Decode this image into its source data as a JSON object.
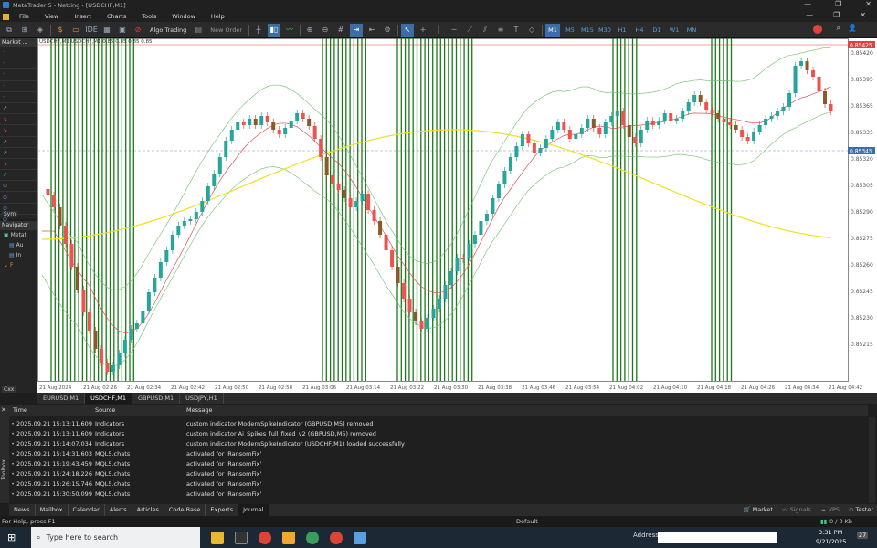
{
  "window": {
    "title": "MetaTrader 5 - Netting - [USDCHF,M1]",
    "minimize": "—",
    "maximize": "❐",
    "close": "✕"
  },
  "menu": {
    "items": [
      "File",
      "View",
      "Insert",
      "Charts",
      "Tools",
      "Window",
      "Help"
    ],
    "controls": [
      "—",
      "❐",
      "✕"
    ]
  },
  "toolbar": {
    "algo_trading_label": "Algo Trading",
    "new_order_label": "New Order",
    "timeframes": [
      "M1",
      "M5",
      "M15",
      "M30",
      "H1",
      "H4",
      "D1",
      "W1",
      "MN"
    ],
    "active_timeframe": "M1",
    "icons": [
      "new-chart-icon",
      "profiles-icon",
      "bar-chart-icon",
      "candle-icon",
      "line-chart-icon",
      "zoom-in-icon",
      "zoom-out-icon",
      "grid-icon",
      "autoscroll-icon",
      "shift-icon",
      "crosshair-icon",
      "cursor-icon",
      "vertical-line-icon",
      "horizontal-line-icon",
      "trendline-icon",
      "channel-icon",
      "fibonacci-icon",
      "text-icon",
      "shapes-icon"
    ]
  },
  "market_watch": {
    "title": "Market ...",
    "rows": [
      "·",
      "·",
      "·",
      "·",
      "·",
      "↗",
      "↘",
      "↘",
      "↗",
      "↗",
      "↘",
      "↗",
      "⊙",
      "⊙",
      "⊙",
      "⊙"
    ],
    "symbols_button": "Sym"
  },
  "navigator": {
    "title": "Navigator",
    "items": [
      "Metat",
      "Au",
      "In",
      "F"
    ]
  },
  "chart": {
    "symbol_label": "USDCHF,M1  USDCHF,M1 0.85 0.85 0.85 0.85",
    "price_labels": [
      "0.85420",
      "0.85395",
      "0.85365",
      "0.85335",
      "0.85320",
      "0.85305",
      "0.85290",
      "0.85275",
      "0.85260",
      "0.85245",
      "0.85230",
      "0.85215"
    ],
    "current_price_high": "0.85425",
    "current_price": "0.85345",
    "time_labels": [
      "21 Aug 2024",
      "21 Aug 02:26",
      "21 Aug 02:34",
      "21 Aug 02:42",
      "21 Aug 02:50",
      "21 Aug 02:58",
      "21 Aug 03:06",
      "21 Aug 03:14",
      "21 Aug 03:22",
      "21 Aug 03:30",
      "21 Aug 03:38",
      "21 Aug 03:46",
      "21 Aug 03:54",
      "21 Aug 04:02",
      "21 Aug 04:10",
      "21 Aug 04:18",
      "21 Aug 04:26",
      "21 Aug 04:34",
      "21 Aug 04:42"
    ]
  },
  "chart_tabs": [
    "EURUSD,M1",
    "USDCHF,M1",
    "GBPUSD,M1",
    "USDJPY,H1"
  ],
  "chart_tabs_active": "USDCHF,M1",
  "close_button": "Cxx",
  "journal": {
    "columns": [
      "Time",
      "Source",
      "Message"
    ],
    "rows": [
      {
        "time": "2025.09.21 15:13:11.609",
        "source": "Indicators",
        "message": "custom indicator ModernSpikeIndicator (GBPUSD,M5) removed"
      },
      {
        "time": "2025.09.21 15:13:11.609",
        "source": "Indicators",
        "message": "custom indicator Ai_Spikes_full_fixed_v2 (GBPUSD,M5) removed"
      },
      {
        "time": "2025.09.21 15:14:07.034",
        "source": "Indicators",
        "message": "custom indicator ModernSpikeIndicator (USDCHF,M1) loaded successfully"
      },
      {
        "time": "2025.09.21 15:14:31.603",
        "source": "MQL5.chats",
        "message": "activated for 'RansomFix'"
      },
      {
        "time": "2025.09.21 15:19:43.459",
        "source": "MQL5.chats",
        "message": "activated for 'RansomFix'"
      },
      {
        "time": "2025.09.21 15:24:18.226",
        "source": "MQL5.chats",
        "message": "activated for 'RansomFix'"
      },
      {
        "time": "2025.09.21 15:26:15.746",
        "source": "MQL5.chats",
        "message": "activated for 'RansomFix'"
      },
      {
        "time": "2025.09.21 15:30:50.099",
        "source": "MQL5.chats",
        "message": "activated for 'RansomFix'"
      }
    ]
  },
  "toolbox_label": "Toolbox",
  "bottom_tabs": [
    "News",
    "Mailbox",
    "Calendar",
    "Alerts",
    "Articles",
    "Code Base",
    "Experts",
    "Journal"
  ],
  "bottom_tabs_active": "Journal",
  "bottom_right": {
    "market": "Market",
    "signals": "Signals",
    "vps": "VPS",
    "tester": "Tester"
  },
  "status": {
    "help": "For Help, press F1",
    "profile": "Default",
    "traffic": "0 / 0 Kb"
  },
  "taskbar": {
    "search_placeholder": "Type here to search",
    "address_label": "Address",
    "time": "3:31 PM",
    "date": "9/21/2025",
    "notifications": "27"
  }
}
